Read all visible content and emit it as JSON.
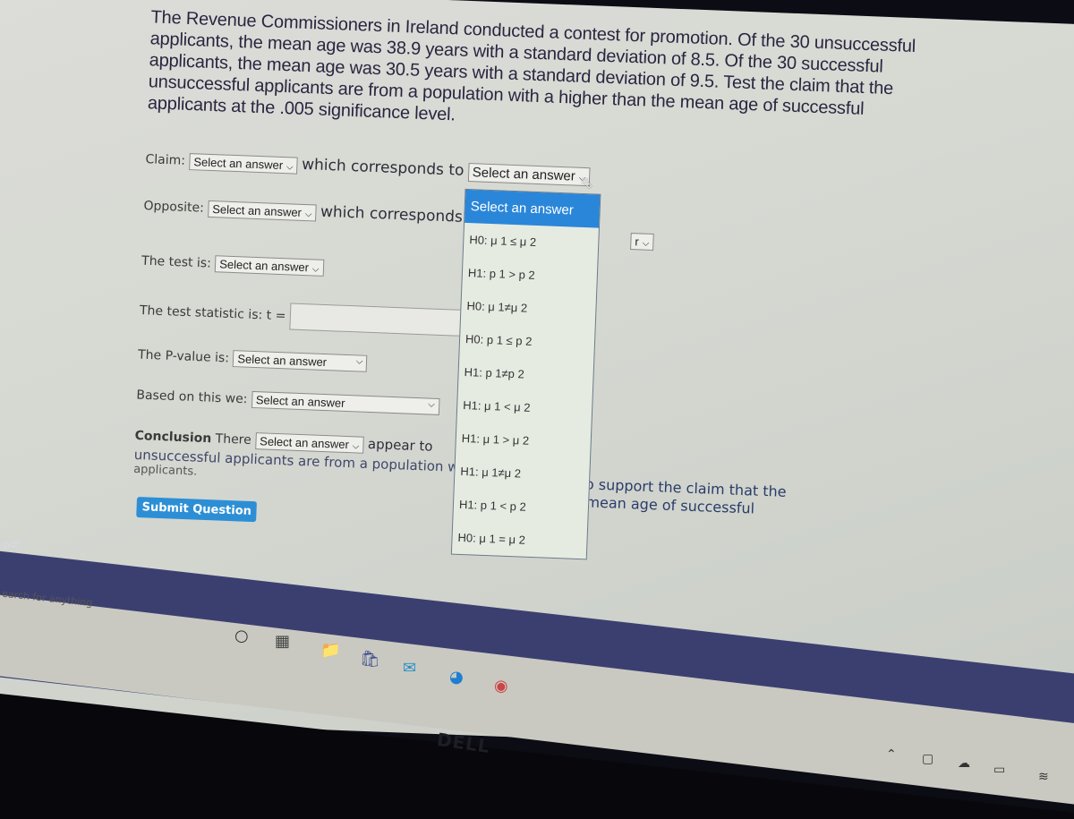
{
  "problem": {
    "text": "The Revenue Commissioners in Ireland conducted a contest for promotion. Of the 30 unsuccessful applicants, the mean age was 38.9 years with a standard deviation of 8.5. Of the 30 successful applicants, the mean age was 30.5 years with a standard deviation of 9.5. Test the claim that the unsuccessful applicants are from a population with a higher than the mean age of successful applicants at the .005 significance level."
  },
  "form": {
    "claim_label": "Claim:",
    "claim_select": "Select an answer",
    "corresponds_to": "which corresponds to",
    "claim_hypothesis_select": "Select an answer",
    "opposite_label": "Opposite:",
    "opposite_select": "Select an answer",
    "opposite_corresponds": "which corresponds",
    "opposite_hypothesis_select_partial": "r",
    "test_label": "The test is:",
    "test_select": "Select an answer",
    "statistic_label": "The test statistic is: t =",
    "statistic_value": "",
    "pvalue_label": "The P-value is:",
    "pvalue_select": "Select an answer",
    "decision_label": "Based on this we:",
    "decision_select": "Select an answer",
    "conclusion_bold": "Conclusion",
    "conclusion_there": "There",
    "conclusion_select": "Select an answer",
    "conclusion_appear": "appear to",
    "conclusion_line2": "unsuccessful applicants are from a population w",
    "conclusion_line3": "applicants.",
    "conclusion_right1": "ce to support the claim that the",
    "conclusion_right2": "the mean age of successful",
    "submit_label": "Submit Question"
  },
  "dropdown": {
    "selected": "Select an answer",
    "options": [
      "Select an answer",
      "H0: μ 1 ≤ μ 2",
      "H1: p 1 > p 2",
      "H0: μ 1≠μ 2",
      "H0: p 1 ≤ p 2",
      "H1: p 1≠p 2",
      "H1: μ 1 < μ 2",
      "H1: μ 1 > μ 2",
      "H1: μ 1≠μ 2",
      "H1: p 1 < p 2",
      "H0: μ 1 = μ 2"
    ]
  },
  "taskbar": {
    "download_file": "-pdf",
    "search_placeholder": "earch for anything",
    "icons": [
      "cortana-icon",
      "task-view-icon",
      "file-explorer-icon",
      "store-icon",
      "mail-icon",
      "edge-icon",
      "chrome-icon"
    ],
    "tray_icons": [
      "chevron-up-icon",
      "meet-now-icon",
      "onedrive-icon",
      "battery-icon",
      "wifi-icon"
    ]
  },
  "brand": {
    "label": "DELL"
  },
  "colors": {
    "accent": "#2a86d9",
    "submit": "#2c8fd6",
    "taskbar_dark": "#3b3f70"
  }
}
